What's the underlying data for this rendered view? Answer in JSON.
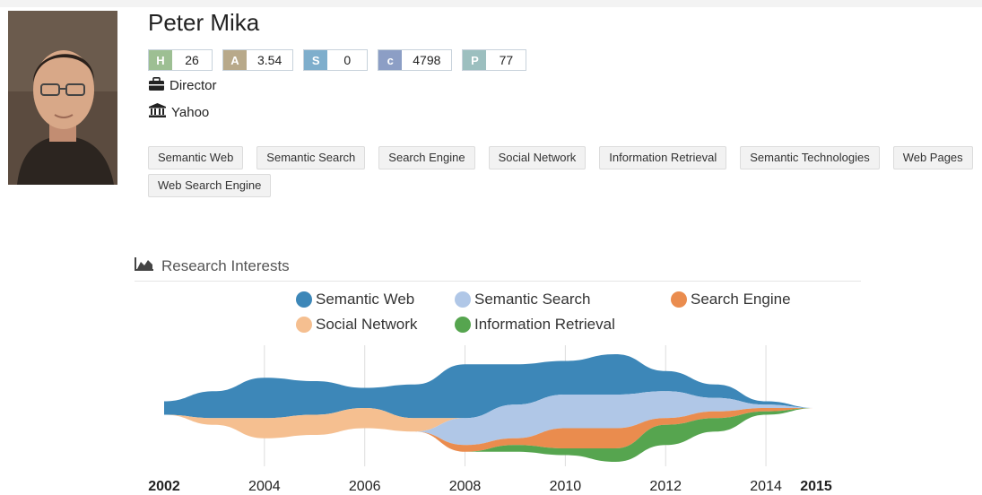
{
  "profile": {
    "name": "Peter Mika",
    "position": "Director",
    "affiliation": "Yahoo"
  },
  "stats": [
    {
      "key": "H",
      "value": "26",
      "color": "#9dbf93"
    },
    {
      "key": "A",
      "value": "3.54",
      "color": "#b8a98a"
    },
    {
      "key": "S",
      "value": "0",
      "color": "#7eaecc"
    },
    {
      "key": "c",
      "value": "4798",
      "color": "#8c9ec5"
    },
    {
      "key": "P",
      "value": "77",
      "color": "#9cbfbf"
    }
  ],
  "icons": {
    "position": "briefcase-icon",
    "affiliation": "institution-icon",
    "section": "area-chart-icon"
  },
  "tags": [
    "Semantic Web",
    "Semantic Search",
    "Search Engine",
    "Social Network",
    "Information Retrieval",
    "Semantic Technologies",
    "Web Pages",
    "Web Search Engine"
  ],
  "research": {
    "title": "Research Interests"
  },
  "chart_data": {
    "type": "area",
    "title": "",
    "xlabel": "",
    "ylabel": "",
    "x": [
      2002,
      2003,
      2004,
      2005,
      2006,
      2007,
      2008,
      2009,
      2010,
      2011,
      2012,
      2013,
      2014,
      2015
    ],
    "tick_labels": [
      "2002",
      "2004",
      "2006",
      "2008",
      "2010",
      "2012",
      "2014",
      "2015"
    ],
    "grid": true,
    "legend": "top",
    "series": [
      {
        "name": "Semantic Web",
        "color": "#3d87b8",
        "values": [
          2,
          4,
          6,
          5,
          3,
          5,
          8,
          6,
          5,
          6,
          3,
          2,
          0.5,
          0
        ]
      },
      {
        "name": "Semantic Search",
        "color": "#b0c7e7",
        "values": [
          0,
          0,
          0,
          0,
          0,
          0,
          4,
          5,
          5,
          5,
          4,
          2,
          0.5,
          0
        ]
      },
      {
        "name": "Search Engine",
        "color": "#ea8c4e",
        "values": [
          0,
          0,
          0,
          0,
          0,
          0,
          1,
          1,
          3,
          3,
          1,
          1,
          0.5,
          0
        ]
      },
      {
        "name": "Social Network",
        "color": "#f5bf90",
        "values": [
          0,
          1,
          3,
          3,
          3,
          2,
          0,
          0,
          0,
          0,
          0,
          0,
          0,
          0
        ]
      },
      {
        "name": "Information Retrieval",
        "color": "#56a54f",
        "values": [
          0,
          0,
          0,
          0,
          0,
          0,
          0,
          1,
          1,
          2,
          3,
          2,
          0.5,
          0
        ]
      }
    ]
  }
}
